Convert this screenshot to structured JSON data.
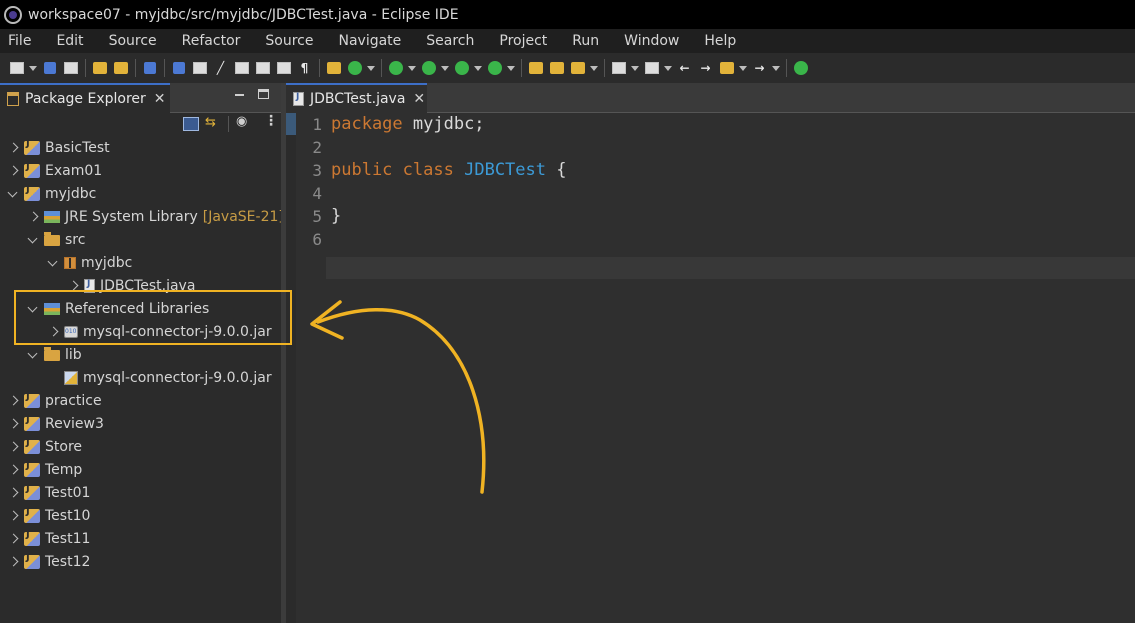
{
  "window": {
    "title": "workspace07 - myjdbc/src/myjdbc/JDBCTest.java - Eclipse IDE"
  },
  "menu": {
    "items": [
      "File",
      "Edit",
      "Source",
      "Refactor",
      "Source",
      "Navigate",
      "Search",
      "Project",
      "Run",
      "Window",
      "Help"
    ]
  },
  "explorer": {
    "tab_label": "Package Explorer",
    "tree": [
      {
        "label": "BasicTest",
        "icon": "project-icon",
        "expanded": false
      },
      {
        "label": "Exam01",
        "icon": "project-icon",
        "expanded": false
      },
      {
        "label": "myjdbc",
        "icon": "project-icon",
        "expanded": true
      },
      {
        "label": "JRE System Library",
        "decoration": "[JavaSE-21]",
        "icon": "library-icon",
        "expanded": false
      },
      {
        "label": "src",
        "icon": "source-folder-icon",
        "expanded": true
      },
      {
        "label": "myjdbc",
        "icon": "package-icon",
        "expanded": true
      },
      {
        "label": "JDBCTest.java",
        "icon": "java-file-icon",
        "expanded": false
      },
      {
        "label": "Referenced Libraries",
        "icon": "library-icon",
        "expanded": true
      },
      {
        "label": "mysql-connector-j-9.0.0.jar",
        "icon": "jar-icon",
        "expanded": false
      },
      {
        "label": "lib",
        "icon": "folder-icon",
        "expanded": true
      },
      {
        "label": "mysql-connector-j-9.0.0.jar",
        "icon": "jar-file-icon",
        "expanded": null
      },
      {
        "label": "practice",
        "icon": "project-icon",
        "expanded": false
      },
      {
        "label": "Review3",
        "icon": "project-icon",
        "expanded": false
      },
      {
        "label": "Store",
        "icon": "project-icon",
        "expanded": false
      },
      {
        "label": "Temp",
        "icon": "project-icon",
        "expanded": false
      },
      {
        "label": "Test01",
        "icon": "project-icon",
        "expanded": false
      },
      {
        "label": "Test10",
        "icon": "project-icon",
        "expanded": false
      },
      {
        "label": "Test11",
        "icon": "project-icon",
        "expanded": false
      },
      {
        "label": "Test12",
        "icon": "project-icon",
        "expanded": false
      }
    ]
  },
  "editor": {
    "tab_label": "JDBCTest.java",
    "line_numbers": [
      "1",
      "2",
      "3",
      "4",
      "5",
      "6"
    ],
    "code": {
      "line1_kw": "package",
      "line1_rest": " myjdbc;",
      "line3_kw1": "public",
      "line3_kw2": "class",
      "line3_cls": "JDBCTest",
      "line3_rest": " {",
      "line5": "}"
    }
  },
  "colors": {
    "annotation": "#f0b323",
    "keyword": "#cc7832",
    "class_name": "#3c9ad6"
  }
}
